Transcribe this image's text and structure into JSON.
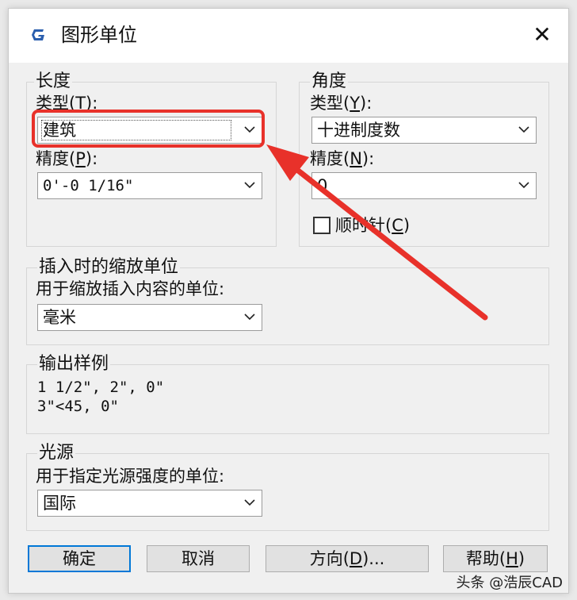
{
  "window": {
    "title": "图形单位",
    "app_icon": "G",
    "close": "✕"
  },
  "length": {
    "legend": "长度",
    "type_label": "类型(",
    "type_hotkey": "T",
    "type_label_end": "):",
    "type_value": "建筑",
    "precision_label": "精度(",
    "precision_hotkey": "P",
    "precision_label_end": "):",
    "precision_value": "0'-0 1/16\""
  },
  "angle": {
    "legend": "角度",
    "type_label": "类型(",
    "type_hotkey": "Y",
    "type_label_end": "):",
    "type_value": "十进制度数",
    "precision_label": "精度(",
    "precision_hotkey": "N",
    "precision_label_end": "):",
    "precision_value": "0",
    "clockwise_label": "顺时针(",
    "clockwise_hotkey": "C",
    "clockwise_label_end": ")",
    "clockwise_checked": false
  },
  "insertion_scale": {
    "legend": "插入时的缩放单位",
    "description": "用于缩放插入内容的单位:",
    "value": "毫米"
  },
  "output_sample": {
    "legend": "输出样例",
    "line1": "1 1/2\", 2\", 0\"",
    "line2": "3\"<45, 0\""
  },
  "lighting": {
    "legend": "光源",
    "description": "用于指定光源强度的单位:",
    "value": "国际"
  },
  "buttons": {
    "ok": "确定",
    "cancel": "取消",
    "direction": "方向(",
    "direction_hotkey": "D",
    "direction_end": ")...",
    "help": "帮助(",
    "help_hotkey": "H",
    "help_end": ")"
  },
  "watermark": "头条 @浩辰CAD",
  "colors": {
    "accent": "#0078d7",
    "annotation": "#e8312a",
    "dialog_bg": "#f0f0f0"
  },
  "icons": [
    "app-logo-icon",
    "close-icon",
    "chevron-down-icon",
    "checkbox-icon",
    "arrow-annotation"
  ]
}
